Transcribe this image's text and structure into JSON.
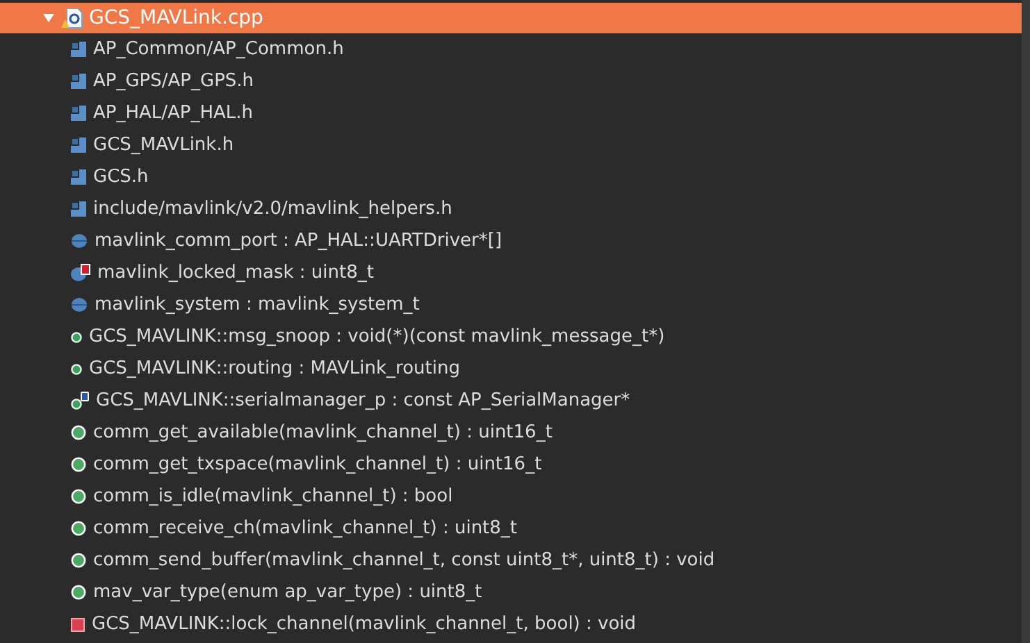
{
  "root": {
    "label": "GCS_MAVLink.cpp",
    "expanded": true,
    "selected": true,
    "children": [
      {
        "kind": "include",
        "label": "AP_Common/AP_Common.h"
      },
      {
        "kind": "include",
        "label": "AP_GPS/AP_GPS.h"
      },
      {
        "kind": "include",
        "label": "AP_HAL/AP_HAL.h"
      },
      {
        "kind": "include",
        "label": "GCS_MAVLink.h"
      },
      {
        "kind": "include",
        "label": "GCS.h"
      },
      {
        "kind": "include",
        "label": "include/mavlink/v2.0/mavlink_helpers.h"
      },
      {
        "kind": "variable",
        "label": "mavlink_comm_port : AP_HAL::UARTDriver*[]"
      },
      {
        "kind": "static-variable",
        "label": "mavlink_locked_mask : uint8_t"
      },
      {
        "kind": "variable",
        "label": "mavlink_system : mavlink_system_t"
      },
      {
        "kind": "field",
        "label": "GCS_MAVLINK::msg_snoop : void(*)(const mavlink_message_t*)"
      },
      {
        "kind": "field",
        "label": "GCS_MAVLINK::routing : MAVLink_routing"
      },
      {
        "kind": "const-field",
        "label": "GCS_MAVLINK::serialmanager_p : const AP_SerialManager*"
      },
      {
        "kind": "function",
        "label": "comm_get_available(mavlink_channel_t) : uint16_t"
      },
      {
        "kind": "function",
        "label": "comm_get_txspace(mavlink_channel_t) : uint16_t"
      },
      {
        "kind": "function",
        "label": "comm_is_idle(mavlink_channel_t) : bool"
      },
      {
        "kind": "function",
        "label": "comm_receive_ch(mavlink_channel_t) : uint8_t"
      },
      {
        "kind": "function",
        "label": "comm_send_buffer(mavlink_channel_t, const uint8_t*, uint8_t) : void"
      },
      {
        "kind": "function",
        "label": "mav_var_type(enum ap_var_type) : uint8_t"
      },
      {
        "kind": "private-function",
        "label": "GCS_MAVLINK::lock_channel(mavlink_channel_t, bool) : void"
      }
    ]
  }
}
